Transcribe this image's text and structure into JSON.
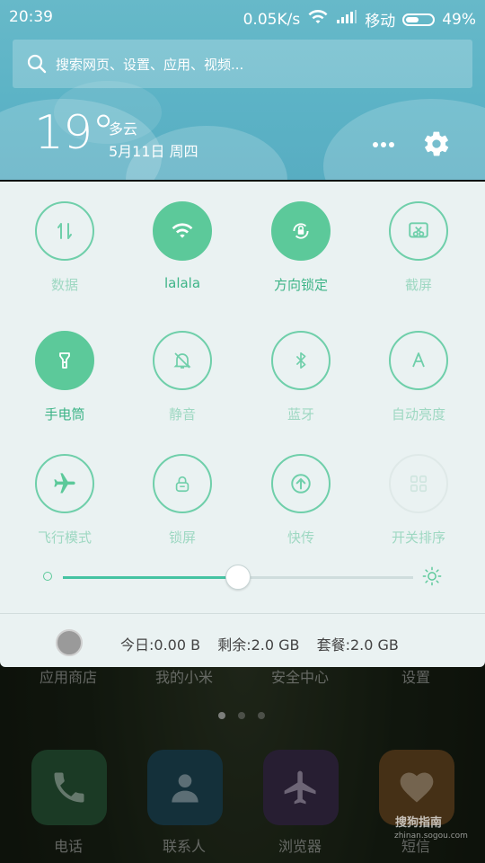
{
  "status": {
    "time": "20:39",
    "speed": "0.05K/s",
    "carrier": "移动",
    "battery_text": "49%",
    "battery_level": 0.49
  },
  "search": {
    "placeholder": "搜索网页、设置、应用、视频..."
  },
  "weather": {
    "temp": "19°",
    "condition": "多云",
    "date": "5月11日 周四"
  },
  "toggles": [
    {
      "label": "数据",
      "icon": "data-icon",
      "state": "off"
    },
    {
      "label": "lalala",
      "icon": "wifi-icon",
      "state": "on"
    },
    {
      "label": "方向锁定",
      "icon": "rotation-lock-icon",
      "state": "on"
    },
    {
      "label": "截屏",
      "icon": "screenshot-icon",
      "state": "off"
    },
    {
      "label": "手电筒",
      "icon": "flashlight-icon",
      "state": "on"
    },
    {
      "label": "静音",
      "icon": "mute-icon",
      "state": "off"
    },
    {
      "label": "蓝牙",
      "icon": "bluetooth-icon",
      "state": "off"
    },
    {
      "label": "自动亮度",
      "icon": "auto-brightness-icon",
      "state": "off"
    },
    {
      "label": "飞行模式",
      "icon": "airplane-icon",
      "state": "off"
    },
    {
      "label": "锁屏",
      "icon": "lock-icon",
      "state": "off"
    },
    {
      "label": "快传",
      "icon": "fast-transfer-icon",
      "state": "off"
    },
    {
      "label": "开关排序",
      "icon": "sort-grid-icon",
      "state": "off"
    }
  ],
  "brightness": {
    "level": 0.5
  },
  "data_usage": {
    "today": "今日:0.00 B",
    "remaining": "剩余:2.0 GB",
    "plan": "套餐:2.0 GB"
  },
  "home": {
    "row_labels": [
      "应用商店",
      "我的小米",
      "安全中心",
      "设置"
    ],
    "dock_labels": [
      "电话",
      "联系人",
      "浏览器",
      "短信"
    ]
  },
  "watermark": {
    "brand": "搜狗指南",
    "url": "zhinan.sogou.com"
  },
  "colors": {
    "accent": "#5cc99a",
    "header": "#5cb3c6",
    "panel": "#eaf2f2"
  }
}
